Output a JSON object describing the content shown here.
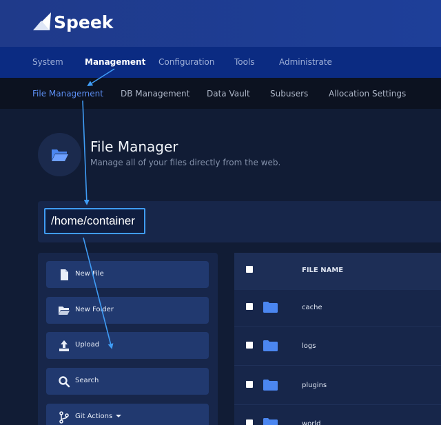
{
  "brand": {
    "name": "Speek"
  },
  "main_nav": {
    "items": [
      {
        "label": "System"
      },
      {
        "label": "Management",
        "active": true
      },
      {
        "label": "Configuration"
      },
      {
        "label": "Tools"
      },
      {
        "label": "Administrate"
      }
    ]
  },
  "sub_nav": {
    "items": [
      {
        "label": "File Management",
        "active": true
      },
      {
        "label": "DB Management"
      },
      {
        "label": "Data Vault"
      },
      {
        "label": "Subusers"
      },
      {
        "label": "Allocation Settings"
      }
    ]
  },
  "page": {
    "title": "File Manager",
    "subtitle": "Manage all of your files directly from the web.",
    "icon": "folder-open-icon"
  },
  "path": {
    "value": "/home/container"
  },
  "actions": [
    {
      "label": "New File",
      "icon": "file-icon"
    },
    {
      "label": "New Folder",
      "icon": "folder-open-icon"
    },
    {
      "label": "Upload",
      "icon": "upload-icon"
    },
    {
      "label": "Search",
      "icon": "search-icon"
    },
    {
      "label": "Git Actions",
      "icon": "git-branch-icon"
    }
  ],
  "file_table": {
    "header": "FILE NAME",
    "files": [
      {
        "name": "cache"
      },
      {
        "name": "logs"
      },
      {
        "name": "plugins"
      },
      {
        "name": "world"
      }
    ]
  },
  "colors": {
    "brand_bar": "#1f3a8a",
    "main_nav": "#0b2b82",
    "sub_nav": "#0c1220",
    "accent": "#3f9cf5",
    "folder": "#4b86f0"
  }
}
